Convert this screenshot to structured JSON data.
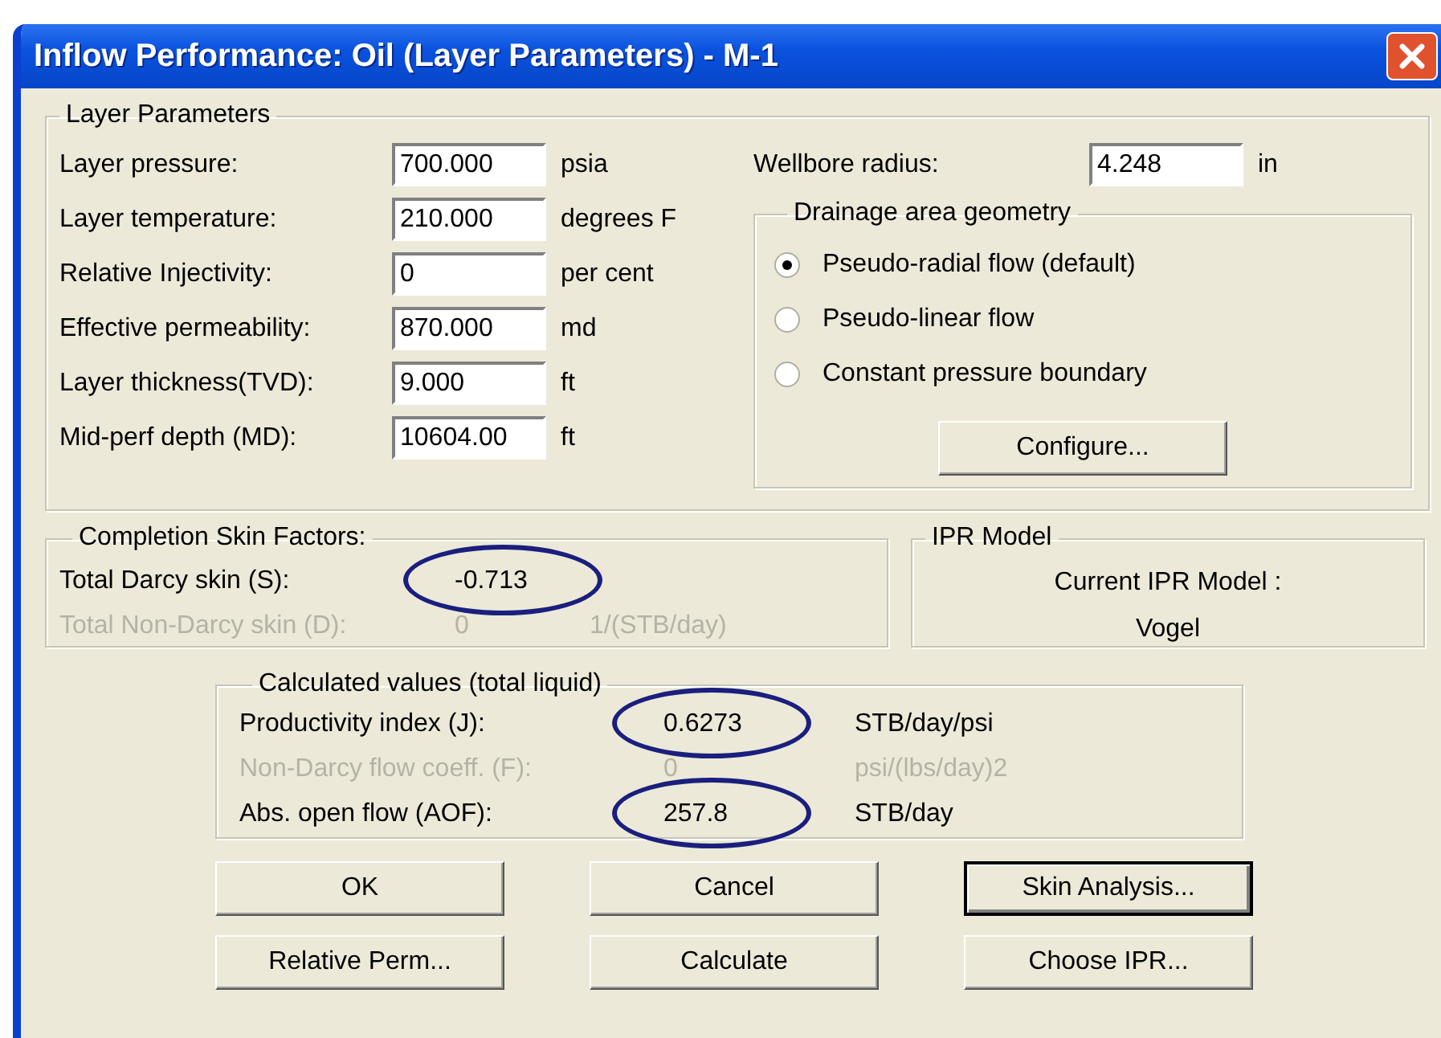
{
  "window": {
    "title": "Inflow Performance: Oil (Layer Parameters) - M-1"
  },
  "layer_parameters": {
    "title": "Layer Parameters",
    "fields": [
      {
        "label": "Layer pressure:",
        "value": "700.000",
        "unit": "psia"
      },
      {
        "label": "Layer temperature:",
        "value": "210.000",
        "unit": "degrees F"
      },
      {
        "label": "Relative Injectivity:",
        "value": "0",
        "unit": "per cent"
      },
      {
        "label": "Effective permeability:",
        "value": "870.000",
        "unit": "md"
      },
      {
        "label": "Layer thickness(TVD):",
        "value": "9.000",
        "unit": "ft"
      },
      {
        "label": "Mid-perf depth (MD):",
        "value": "10604.00",
        "unit": "ft"
      }
    ],
    "wellbore_radius": {
      "label": "Wellbore radius:",
      "value": "4.248",
      "unit": "in"
    },
    "drainage_area_geometry": {
      "title": "Drainage area geometry",
      "options": [
        {
          "label": "Pseudo-radial flow (default)",
          "selected": true
        },
        {
          "label": "Pseudo-linear flow",
          "selected": false
        },
        {
          "label": "Constant pressure boundary",
          "selected": false
        }
      ],
      "button": "Configure..."
    }
  },
  "completion_skin_factors": {
    "title": "Completion Skin Factors:",
    "rows": [
      {
        "label": "Total Darcy skin (S):",
        "value": "-0.713",
        "disabled": false,
        "circled": true
      },
      {
        "label": "Total Non-Darcy skin (D):",
        "value": "0",
        "unit": "1/(STB/day)",
        "disabled": true,
        "circled": false
      }
    ]
  },
  "ipr_model": {
    "title": "IPR Model",
    "label": "Current IPR Model :",
    "value": "Vogel"
  },
  "calculated_values": {
    "title": "Calculated values (total liquid)",
    "rows": [
      {
        "label": "Productivity index (J):",
        "value": "0.6273",
        "unit": "STB/day/psi",
        "disabled": false,
        "circled": true
      },
      {
        "label": "Non-Darcy flow coeff. (F):",
        "value": "0",
        "unit": "psi/(lbs/day)2",
        "disabled": true,
        "circled": false
      },
      {
        "label": "Abs. open flow (AOF):",
        "value": "257.8",
        "unit": "STB/day",
        "disabled": false,
        "circled": true
      }
    ]
  },
  "buttons": [
    {
      "label": "OK",
      "default": false
    },
    {
      "label": "Cancel",
      "default": false
    },
    {
      "label": "Skin Analysis...",
      "default": true
    },
    {
      "label": "Relative Perm...",
      "default": false
    },
    {
      "label": "Calculate",
      "default": false
    },
    {
      "label": "Choose IPR...",
      "default": false
    }
  ]
}
